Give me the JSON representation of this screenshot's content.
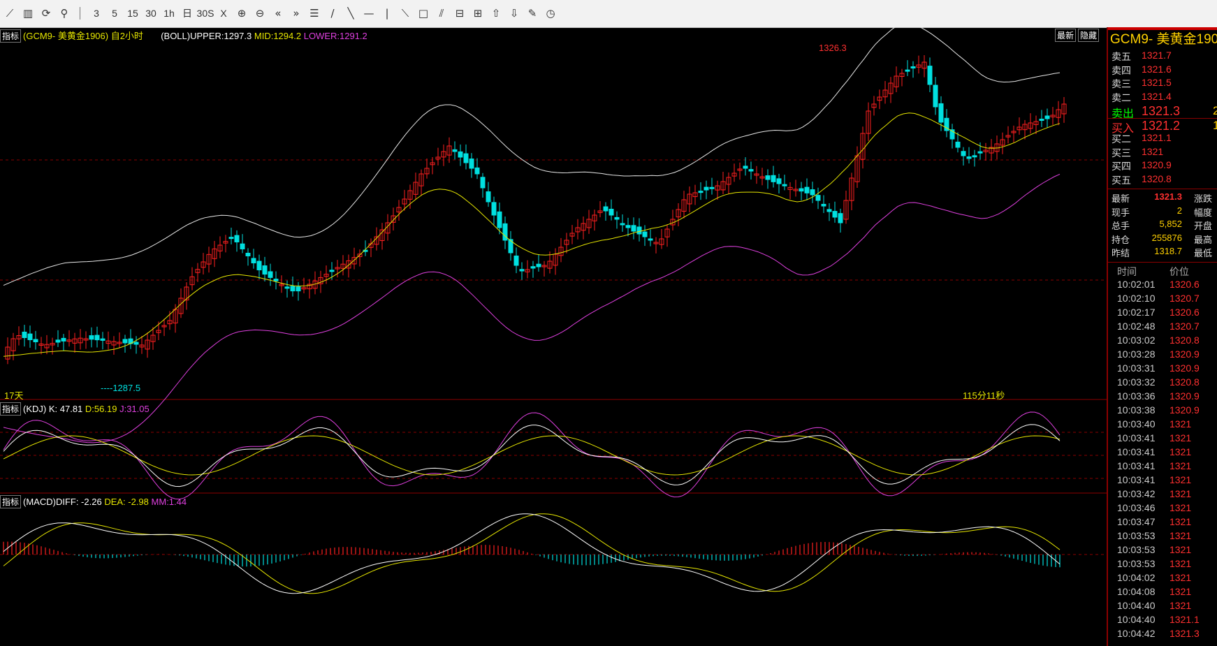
{
  "toolbar": {
    "items": [
      "line-chart-icon",
      "bars-icon",
      "refresh-icon",
      "zoom-tool-icon",
      "|",
      "3",
      "5",
      "15",
      "30",
      "1h",
      "日",
      "30S",
      "X",
      "zoom-in-icon",
      "zoom-out-icon",
      "scroll-left-icon",
      "scroll-right-icon",
      "list-icon",
      "draw-line-icon",
      "draw-ray-icon",
      "draw-horizontal-icon",
      "draw-vertical-icon",
      "draw-segment-icon",
      "draw-rect-icon",
      "draw-parallel-icon",
      "text-icon",
      "abc-icon",
      "arrow-up-icon",
      "arrow-down-icon",
      "pencil-icon",
      "clock-icon"
    ]
  },
  "main": {
    "btn_label": "指标",
    "title": "(GCM9-  美黄金1906) 自2小时",
    "boll": {
      "upper": "(BOLL)UPPER:1297.3",
      "mid": "MID:1294.2",
      "lower": "LOWER:1291.2"
    },
    "latest_btn": "最新",
    "hide_btn": "隐藏",
    "high_label": "1326.3",
    "low_label": "----1287.5",
    "left_note": "17天",
    "right_note": "115分11秒",
    "colors": {
      "up": "#ff2020",
      "down": "#00e0e0",
      "mid": "#e6e600",
      "lower": "#e040e0",
      "upper": "#e8e8e8"
    }
  },
  "kdj": {
    "btn_label": "指标",
    "name": "(KDJ)",
    "k": "K: 47.81",
    "d": "D:56.19",
    "j": "J:31.05"
  },
  "macd": {
    "btn_label": "指标",
    "name": "(MACD)DIFF: -2.26",
    "dea": "DEA: -2.98",
    "mm": "MM:1.44"
  },
  "panel": {
    "title": "GCM9- 美黄金190",
    "asks": [
      {
        "label": "卖五",
        "price": "1321.7"
      },
      {
        "label": "卖四",
        "price": "1321.6"
      },
      {
        "label": "卖三",
        "price": "1321.5"
      },
      {
        "label": "卖二",
        "price": "1321.4"
      }
    ],
    "sell": {
      "label": "卖出",
      "price": "1321.3",
      "qty": "2"
    },
    "buy": {
      "label": "买入",
      "price": "1321.2",
      "qty": "1"
    },
    "bids": [
      {
        "label": "买二",
        "price": "1321.1"
      },
      {
        "label": "买三",
        "price": "1321"
      },
      {
        "label": "买四",
        "price": "1320.9"
      },
      {
        "label": "买五",
        "price": "1320.8"
      }
    ],
    "stats": [
      {
        "label": "最新",
        "value": "1321.3",
        "right": "涨跌"
      },
      {
        "label": "现手",
        "value": "2",
        "right": "幅度"
      },
      {
        "label": "总手",
        "value": "5,852",
        "right": "开盘"
      },
      {
        "label": "持仓",
        "value": "255876",
        "right": "最高"
      },
      {
        "label": "昨结",
        "value": "1318.7",
        "right": "最低"
      }
    ],
    "ticks_header": {
      "time": "时间",
      "price": "价位"
    },
    "ticks": [
      {
        "t": "10:02:01",
        "p": "1320.6"
      },
      {
        "t": "10:02:10",
        "p": "1320.7"
      },
      {
        "t": "10:02:17",
        "p": "1320.6"
      },
      {
        "t": "10:02:48",
        "p": "1320.7"
      },
      {
        "t": "10:03:02",
        "p": "1320.8"
      },
      {
        "t": "10:03:28",
        "p": "1320.9"
      },
      {
        "t": "10:03:31",
        "p": "1320.9"
      },
      {
        "t": "10:03:32",
        "p": "1320.8"
      },
      {
        "t": "10:03:36",
        "p": "1320.9"
      },
      {
        "t": "10:03:38",
        "p": "1320.9"
      },
      {
        "t": "10:03:40",
        "p": "1321"
      },
      {
        "t": "10:03:41",
        "p": "1321"
      },
      {
        "t": "10:03:41",
        "p": "1321"
      },
      {
        "t": "10:03:41",
        "p": "1321"
      },
      {
        "t": "10:03:41",
        "p": "1321"
      },
      {
        "t": "10:03:42",
        "p": "1321"
      },
      {
        "t": "10:03:46",
        "p": "1321"
      },
      {
        "t": "10:03:47",
        "p": "1321"
      },
      {
        "t": "10:03:53",
        "p": "1321"
      },
      {
        "t": "10:03:53",
        "p": "1321"
      },
      {
        "t": "10:03:53",
        "p": "1321"
      },
      {
        "t": "10:04:02",
        "p": "1321"
      },
      {
        "t": "10:04:08",
        "p": "1321"
      },
      {
        "t": "10:04:40",
        "p": "1321"
      },
      {
        "t": "10:04:40",
        "p": "1321.1"
      },
      {
        "t": "10:04:42",
        "p": "1321.3"
      }
    ]
  }
}
